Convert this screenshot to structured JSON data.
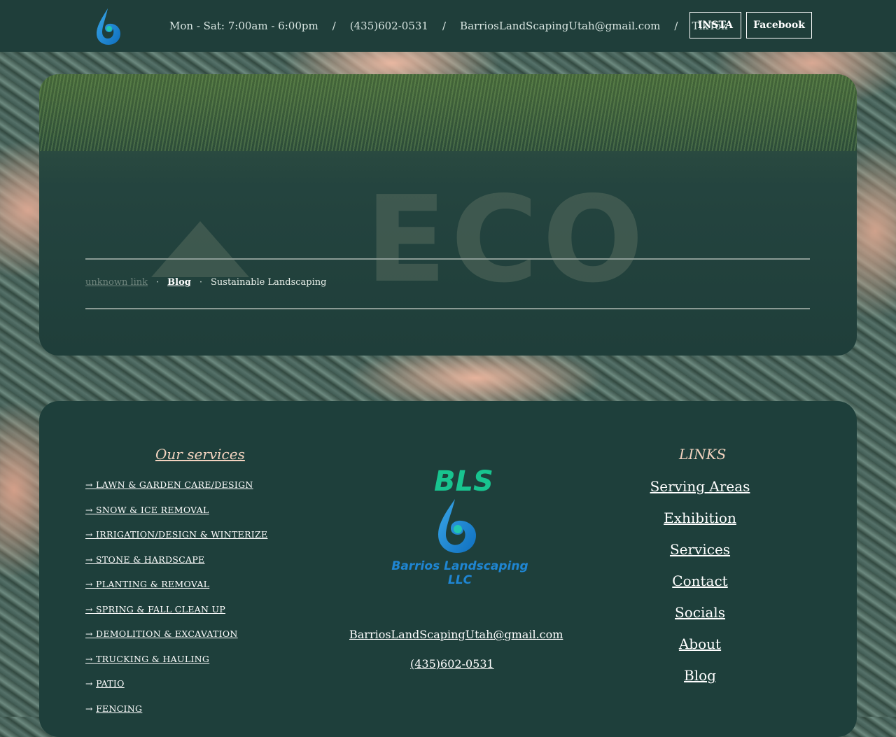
{
  "header": {
    "hours": "Mon - Sat: 7:00am - 6:00pm",
    "separator": "/",
    "phone": "(435)602-0531",
    "email": "BarriosLandScapingUtah@gmail.com",
    "tiktok": "TikTok",
    "insta_button": "INSTA",
    "facebook_button": "Facebook"
  },
  "hero": {
    "image_word": "ECO",
    "breadcrumb": {
      "item1": "unknown link",
      "sep": "·",
      "item2": "Blog",
      "item3": "Sustainable Landscaping"
    }
  },
  "footer": {
    "services_title": "Our services",
    "services": [
      "→ LAWN & GARDEN CARE/DESIGN",
      "→ SNOW & ICE REMOVAL",
      "→ IRRIGATION/DESIGN & WINTERIZE",
      "→ STONE & HARDSCAPE",
      "→ PLANTING & REMOVAL",
      "→ SPRING & FALL CLEAN UP",
      "→ DEMOLITION & EXCAVATION",
      "→ TRUCKING & HAULING",
      "PATIO",
      "FENCING"
    ],
    "arrow": "→ ",
    "brand_short": "BLS",
    "brand_name": "Barrios Landscaping LLC",
    "email": "BarriosLandScapingUtah@gmail.com",
    "phone": "(435)602-0531",
    "links_title": "LINKS",
    "links": [
      "Serving Areas",
      "Exhibition",
      "Services",
      "Contact",
      "Socials",
      "About",
      "Blog"
    ]
  },
  "colors": {
    "header_bg": "#1f3e3a",
    "accent_peach": "#f2d3bf",
    "brand_green": "#18c48f",
    "brand_blue": "#1f86d3"
  }
}
